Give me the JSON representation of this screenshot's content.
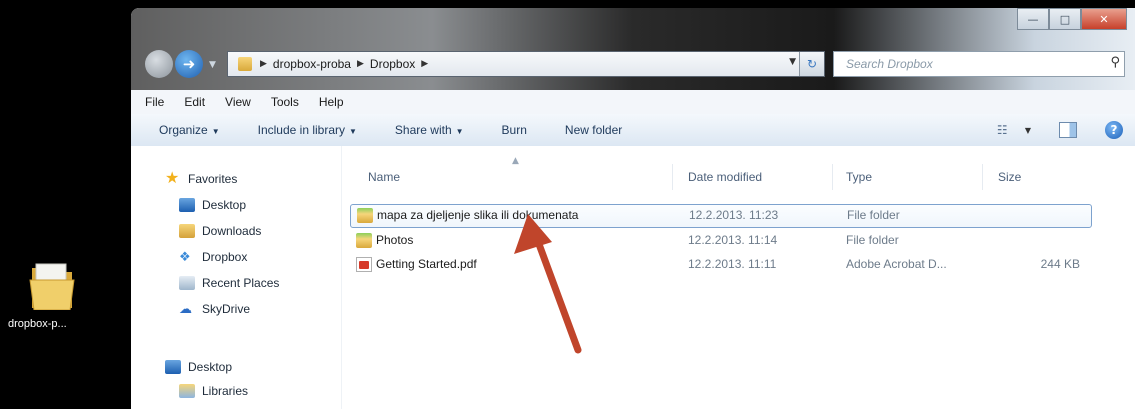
{
  "desktop": {
    "folder_label": "dropbox-p..."
  },
  "window": {
    "address": {
      "crumbs": [
        "dropbox-proba",
        "Dropbox"
      ]
    },
    "search": {
      "placeholder": "Search Dropbox"
    },
    "menu": [
      "File",
      "Edit",
      "View",
      "Tools",
      "Help"
    ],
    "commands": [
      {
        "label": "Organize",
        "dropdown": true
      },
      {
        "label": "Include in library",
        "dropdown": true
      },
      {
        "label": "Share with",
        "dropdown": true
      },
      {
        "label": "Burn",
        "dropdown": false
      },
      {
        "label": "New folder",
        "dropdown": false
      }
    ]
  },
  "nav_pane": {
    "favorites_title": "Favorites",
    "favorites": [
      "Desktop",
      "Downloads",
      "Dropbox",
      "Recent Places",
      "SkyDrive"
    ],
    "tree": [
      "Desktop",
      "Libraries"
    ]
  },
  "columns": {
    "name": "Name",
    "date": "Date modified",
    "type": "Type",
    "size": "Size"
  },
  "files": [
    {
      "name": "mapa za djeljenje slika ili dokumenata",
      "date": "12.2.2013. 11:23",
      "type": "File folder",
      "size": "",
      "icon": "folder-icon",
      "selected": true
    },
    {
      "name": "Photos",
      "date": "12.2.2013. 11:14",
      "type": "File folder",
      "size": "",
      "icon": "folder-icon",
      "selected": false
    },
    {
      "name": "Getting Started.pdf",
      "date": "12.2.2013. 11:11",
      "type": "Adobe Acrobat D...",
      "size": "244 KB",
      "icon": "pdf-icon",
      "selected": false
    }
  ],
  "annotation": {
    "arrow_color": "#c0452b"
  }
}
